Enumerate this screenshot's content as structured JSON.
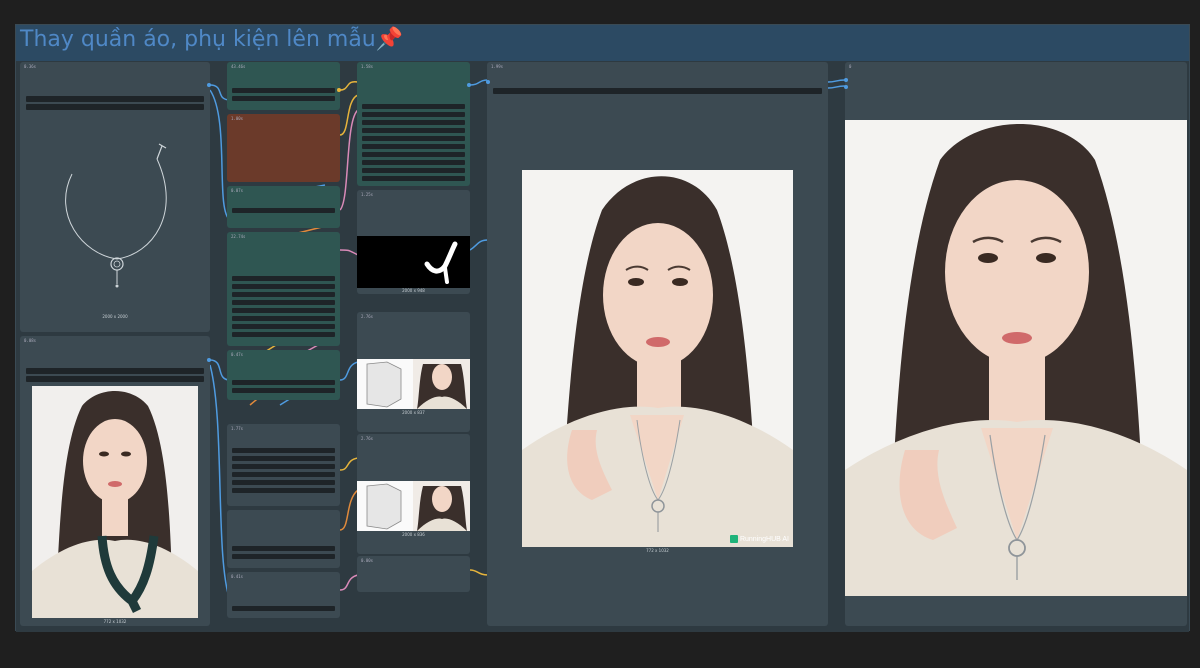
{
  "group": {
    "title": "Thay quần áo, phụ kiện lên mẫu📌"
  },
  "nodes": {
    "load_necklace": {
      "title": "0.36s",
      "caption": "2000 x 2000"
    },
    "load_model": {
      "title": "0.08s",
      "caption": "772 x 1032"
    },
    "col2_a": {
      "title": "43.46s"
    },
    "col2_b": {
      "title": "1.00s"
    },
    "col2_c": {
      "title": "0.07s"
    },
    "col2_d": {
      "title": "22.74s"
    },
    "col2_e": {
      "title": "0.47s"
    },
    "col2_f": {
      "title": "1.77s"
    },
    "col2_g": {
      "title": "0.41s"
    },
    "col3_a": {
      "title": "1.58s"
    },
    "col3_mask": {
      "title": "1.25s",
      "caption": "2000 x 948"
    },
    "col3_comp1": {
      "title": "2.76s",
      "caption": "2000 x 837"
    },
    "col3_comp2": {
      "title": "2.76s",
      "caption": "2000 x 836"
    },
    "col3_b": {
      "title": "0.00s"
    },
    "preview": {
      "title": "1.99s",
      "caption": "772 x 1032",
      "watermark": "RunningHUB AI"
    },
    "output": {
      "title": "0"
    }
  },
  "colors": {
    "background": "#1f1f1f",
    "group_header": "#2c4a63",
    "group_title": "#4f88c6",
    "node": "#3c4a52",
    "node_teal": "#2f5652",
    "node_brown": "#6b3a2a",
    "wire_blue": "#4f9be0",
    "wire_yellow": "#e6b43c",
    "wire_orange": "#e08a3c",
    "wire_pink": "#d98ab8"
  }
}
